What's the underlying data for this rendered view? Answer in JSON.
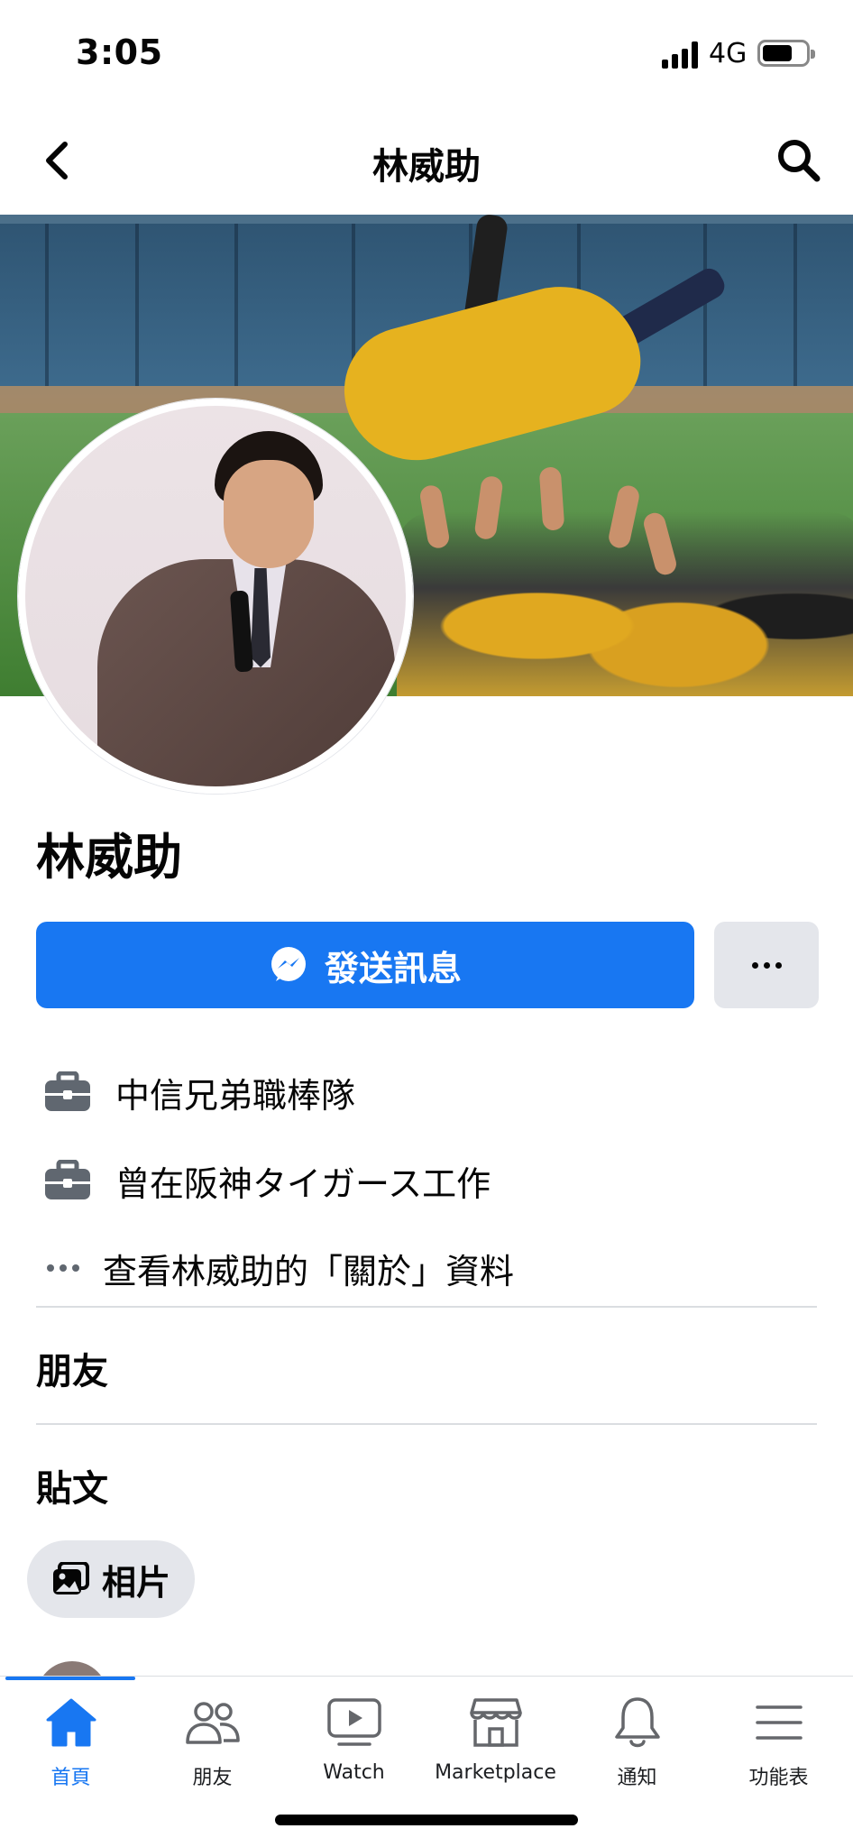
{
  "status_bar": {
    "time": "3:05",
    "network": "4G"
  },
  "nav": {
    "title": "林威助"
  },
  "profile": {
    "name": "林威助",
    "message_button": "發送訊息"
  },
  "info": [
    {
      "icon": "briefcase-icon",
      "text": "中信兄弟職棒隊"
    },
    {
      "icon": "briefcase-icon",
      "text": "曾在阪神タイガース工作"
    },
    {
      "icon": "more-dots-icon",
      "text": "查看林威助的「關於」資料"
    }
  ],
  "sections": {
    "friends": "朋友",
    "posts": "貼文"
  },
  "photos_chip": {
    "label": "相片"
  },
  "tabs": [
    {
      "label": "首頁",
      "icon": "home-icon",
      "active": true
    },
    {
      "label": "朋友",
      "icon": "friends-icon",
      "active": false
    },
    {
      "label": "Watch",
      "icon": "watch-icon",
      "active": false
    },
    {
      "label": "Marketplace",
      "icon": "marketplace-icon",
      "active": false
    },
    {
      "label": "通知",
      "icon": "bell-icon",
      "active": false
    },
    {
      "label": "功能表",
      "icon": "menu-icon",
      "active": false
    }
  ],
  "colors": {
    "accent": "#1877f2",
    "chip_bg": "#e4e6eb",
    "text": "#050505"
  }
}
